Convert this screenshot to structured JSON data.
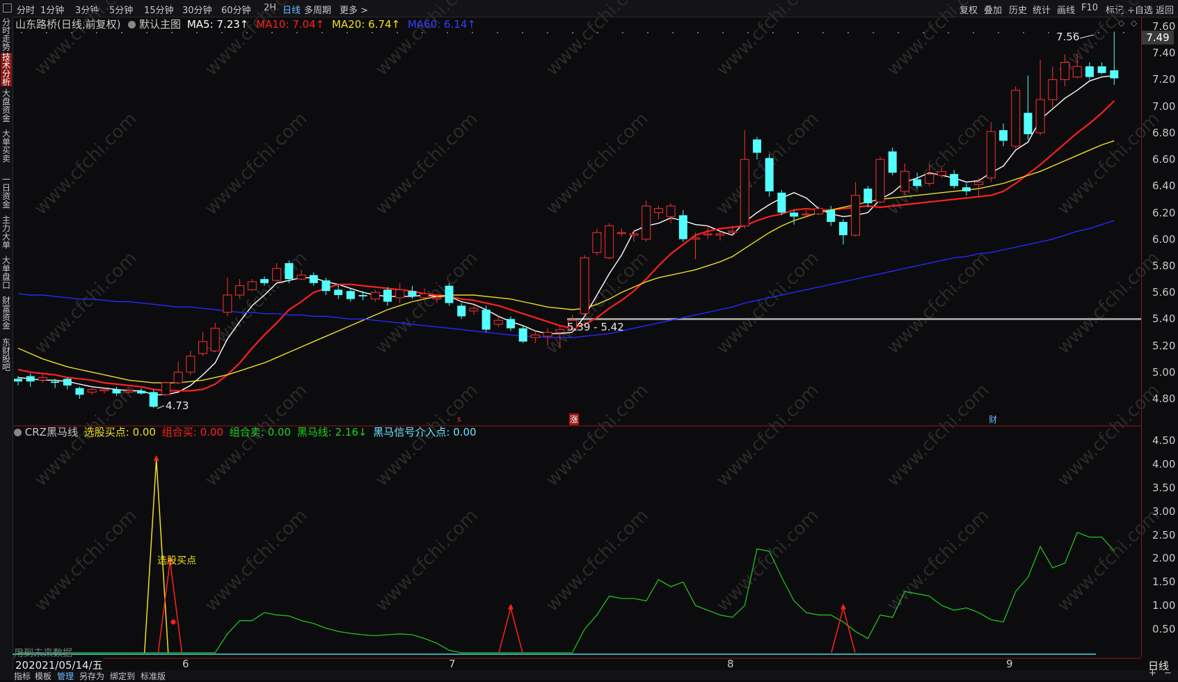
{
  "top_tabs": {
    "left_icon": "window-icon",
    "items": [
      "分时",
      "1分钟",
      "3分钟",
      "5分钟",
      "15分钟",
      "30分钟",
      "60分钟",
      "2H",
      "日线",
      "多周期",
      "更多 >"
    ],
    "active_index": 8,
    "right_items": [
      "复权",
      "叠加",
      "历史",
      "统计",
      "画线",
      "F10",
      "标记",
      "+自选",
      "返回"
    ]
  },
  "sidebar": [
    "分时走势",
    "技术分析",
    "大盘资金",
    "大单买卖",
    "一日资金",
    "主力大单",
    "大单盘口",
    "财富资金",
    "东财股吧"
  ],
  "sidebar_active": 1,
  "main_legend": {
    "title": "山东路桥(日线,前复权)",
    "template": "默认主图",
    "ma5": "MA5: 7.23↑",
    "ma10": "MA10: 7.04↑",
    "ma20": "MA20: 6.74↑",
    "ma60": "MA60: 6.14↑",
    "ma5_color": "#ffffff",
    "ma10_color": "#ff2020",
    "ma20_color": "#f0e020",
    "ma60_color": "#2828ff"
  },
  "price_axis": [
    "7.60",
    "7.40",
    "7.20",
    "7.00",
    "6.80",
    "6.60",
    "6.40",
    "6.20",
    "6.00",
    "5.80",
    "5.60",
    "5.40",
    "5.20",
    "5.00",
    "4.80"
  ],
  "current_price": "7.49",
  "annotations": {
    "high": "7.56",
    "low": "4.73",
    "range": "5.39 - 5.42"
  },
  "markers": {
    "s": "s",
    "zhang": "涨",
    "cai": "财"
  },
  "indicator_legend": {
    "name": "CRZ黑马线",
    "item1": "选股买点: 0.00",
    "item2": "组合买: 0.00",
    "item3": "组合卖: 0.00",
    "item4": "黑马线: 2.16↓",
    "item5": "黑马信号介入点: 0.00"
  },
  "indicator_axis": [
    "4.50",
    "4.00",
    "3.50",
    "3.00",
    "2.50",
    "2.00",
    "1.50",
    "1.00",
    "0.50"
  ],
  "indicator_label": "选股买点",
  "future_data_note": "用到未来数据",
  "date_axis": {
    "first": "2021/05/14/五",
    "months": [
      "6",
      "7",
      "8",
      "9"
    ]
  },
  "period_label": "日线",
  "bottom_tabs": [
    "指标",
    "模板",
    "管理",
    "另存为",
    "绑定到",
    "标准版"
  ],
  "bottom_active": 2,
  "watermark": "www.cfchi.com",
  "chart_data": {
    "type": "candlestick",
    "title": "山东路桥(日线,前复权)",
    "ylim": [
      4.7,
      7.62
    ],
    "candles": [
      [
        4.95,
        4.93,
        4.97,
        4.9
      ],
      [
        4.97,
        4.93,
        4.99,
        4.89
      ],
      [
        4.94,
        4.96,
        4.99,
        4.92
      ],
      [
        4.93,
        4.92,
        4.95,
        4.88
      ],
      [
        4.95,
        4.9,
        4.96,
        4.87
      ],
      [
        4.88,
        4.83,
        4.89,
        4.8
      ],
      [
        4.85,
        4.87,
        4.88,
        4.83
      ],
      [
        4.86,
        4.87,
        4.88,
        4.84
      ],
      [
        4.87,
        4.84,
        4.89,
        4.82
      ],
      [
        4.85,
        4.86,
        4.88,
        4.84
      ],
      [
        4.86,
        4.84,
        4.88,
        4.83
      ],
      [
        4.85,
        4.74,
        4.87,
        4.73
      ],
      [
        4.83,
        4.92,
        4.93,
        4.83
      ],
      [
        4.92,
        5.0,
        5.08,
        4.91
      ],
      [
        5.0,
        5.12,
        5.16,
        4.98
      ],
      [
        5.14,
        5.23,
        5.3,
        5.12
      ],
      [
        5.16,
        5.33,
        5.37,
        5.15
      ],
      [
        5.45,
        5.58,
        5.71,
        5.42
      ],
      [
        5.58,
        5.65,
        5.7,
        5.55
      ],
      [
        5.62,
        5.68,
        5.7,
        5.61
      ],
      [
        5.7,
        5.67,
        5.72,
        5.65
      ],
      [
        5.69,
        5.78,
        5.82,
        5.68
      ],
      [
        5.82,
        5.7,
        5.84,
        5.67
      ],
      [
        5.7,
        5.73,
        5.77,
        5.69
      ],
      [
        5.73,
        5.67,
        5.75,
        5.65
      ],
      [
        5.69,
        5.61,
        5.71,
        5.58
      ],
      [
        5.62,
        5.58,
        5.66,
        5.55
      ],
      [
        5.61,
        5.55,
        5.63,
        5.53
      ],
      [
        5.58,
        5.57,
        5.61,
        5.54
      ],
      [
        5.55,
        5.6,
        5.62,
        5.53
      ],
      [
        5.62,
        5.53,
        5.64,
        5.5
      ],
      [
        5.56,
        5.62,
        5.67,
        5.52
      ],
      [
        5.61,
        5.57,
        5.65,
        5.55
      ],
      [
        5.56,
        5.59,
        5.63,
        5.55
      ],
      [
        5.55,
        5.56,
        5.58,
        5.52
      ],
      [
        5.65,
        5.52,
        5.67,
        5.5
      ],
      [
        5.5,
        5.42,
        5.52,
        5.4
      ],
      [
        5.46,
        5.48,
        5.5,
        5.43
      ],
      [
        5.47,
        5.32,
        5.5,
        5.3
      ],
      [
        5.36,
        5.39,
        5.42,
        5.34
      ],
      [
        5.4,
        5.33,
        5.42,
        5.31
      ],
      [
        5.33,
        5.23,
        5.35,
        5.22
      ],
      [
        5.26,
        5.28,
        5.31,
        5.22
      ],
      [
        5.27,
        5.3,
        5.33,
        5.2
      ],
      [
        5.3,
        5.32,
        5.35,
        5.18
      ],
      [
        5.33,
        5.39,
        5.43,
        5.3
      ],
      [
        5.44,
        5.86,
        5.88,
        5.42
      ],
      [
        5.9,
        6.05,
        6.08,
        5.88
      ],
      [
        5.86,
        6.1,
        6.12,
        5.85
      ],
      [
        6.05,
        6.05,
        6.08,
        6.02
      ],
      [
        6.03,
        6.04,
        6.07,
        5.98
      ],
      [
        6.0,
        6.25,
        6.29,
        5.98
      ],
      [
        6.2,
        6.23,
        6.25,
        6.15
      ],
      [
        6.17,
        6.25,
        6.27,
        6.12
      ],
      [
        6.18,
        6.0,
        6.22,
        5.98
      ],
      [
        6.0,
        6.01,
        6.05,
        5.85
      ],
      [
        6.04,
        6.04,
        6.1,
        6.0
      ],
      [
        6.03,
        6.04,
        6.08,
        5.99
      ],
      [
        6.05,
        6.06,
        6.1,
        6.03
      ],
      [
        6.1,
        6.6,
        6.82,
        6.08
      ],
      [
        6.75,
        6.65,
        6.77,
        6.6
      ],
      [
        6.61,
        6.36,
        6.64,
        6.32
      ],
      [
        6.35,
        6.2,
        6.37,
        6.18
      ],
      [
        6.2,
        6.17,
        6.22,
        6.11
      ],
      [
        6.19,
        6.19,
        6.22,
        6.16
      ],
      [
        6.19,
        6.23,
        6.25,
        6.18
      ],
      [
        6.22,
        6.13,
        6.25,
        6.1
      ],
      [
        6.13,
        6.03,
        6.15,
        5.96
      ],
      [
        6.03,
        6.33,
        6.43,
        6.02
      ],
      [
        6.38,
        6.27,
        6.4,
        6.24
      ],
      [
        6.28,
        6.6,
        6.62,
        6.27
      ],
      [
        6.66,
        6.5,
        6.69,
        6.48
      ],
      [
        6.36,
        6.51,
        6.57,
        6.33
      ],
      [
        6.45,
        6.4,
        6.5,
        6.38
      ],
      [
        6.42,
        6.49,
        6.56,
        6.4
      ],
      [
        6.48,
        6.51,
        6.54,
        6.46
      ],
      [
        6.49,
        6.4,
        6.52,
        6.38
      ],
      [
        6.39,
        6.36,
        6.42,
        6.33
      ],
      [
        6.41,
        6.43,
        6.46,
        6.32
      ],
      [
        6.46,
        6.81,
        6.88,
        6.43
      ],
      [
        6.82,
        6.74,
        6.87,
        6.7
      ],
      [
        6.7,
        7.12,
        7.15,
        6.68
      ],
      [
        6.95,
        6.79,
        7.23,
        6.75
      ],
      [
        6.8,
        7.05,
        7.35,
        6.78
      ],
      [
        7.05,
        7.2,
        7.3,
        6.99
      ],
      [
        7.2,
        7.33,
        7.39,
        7.15
      ],
      [
        7.22,
        7.3,
        7.4,
        7.21
      ],
      [
        7.3,
        7.22,
        7.33,
        7.2
      ],
      [
        7.3,
        7.25,
        7.33,
        7.24
      ],
      [
        7.27,
        7.21,
        7.56,
        7.16
      ]
    ],
    "series": [
      {
        "name": "MA5",
        "color": "#ffffff",
        "values": [
          4.96,
          4.95,
          4.94,
          4.94,
          4.93,
          4.91,
          4.89,
          4.88,
          4.87,
          4.86,
          4.86,
          4.83,
          4.83,
          4.85,
          4.9,
          4.98,
          5.07,
          5.25,
          5.38,
          5.5,
          5.58,
          5.67,
          5.69,
          5.71,
          5.71,
          5.68,
          5.66,
          5.63,
          5.6,
          5.58,
          5.57,
          5.57,
          5.57,
          5.58,
          5.57,
          5.57,
          5.53,
          5.51,
          5.47,
          5.42,
          5.38,
          5.35,
          5.31,
          5.29,
          5.29,
          5.3,
          5.42,
          5.58,
          5.74,
          5.88,
          6.06,
          6.1,
          6.12,
          6.16,
          6.14,
          6.11,
          6.1,
          6.06,
          6.03,
          6.13,
          6.2,
          6.26,
          6.31,
          6.35,
          6.31,
          6.23,
          6.19,
          6.17,
          6.18,
          6.2,
          6.3,
          6.35,
          6.43,
          6.46,
          6.5,
          6.48,
          6.46,
          6.43,
          6.44,
          6.5,
          6.55,
          6.67,
          6.73,
          6.9,
          6.98,
          7.06,
          7.12,
          7.19,
          7.22,
          7.23
        ]
      },
      {
        "name": "MA10",
        "color": "#ff2020",
        "values": [
          5.02,
          5.0,
          4.99,
          4.98,
          4.96,
          4.95,
          4.94,
          4.92,
          4.91,
          4.9,
          4.89,
          4.87,
          4.86,
          4.86,
          4.86,
          4.87,
          4.91,
          4.98,
          5.07,
          5.18,
          5.28,
          5.37,
          5.47,
          5.53,
          5.6,
          5.63,
          5.66,
          5.66,
          5.65,
          5.64,
          5.63,
          5.62,
          5.61,
          5.59,
          5.58,
          5.57,
          5.55,
          5.54,
          5.52,
          5.5,
          5.47,
          5.44,
          5.41,
          5.38,
          5.35,
          5.33,
          5.36,
          5.41,
          5.48,
          5.54,
          5.61,
          5.7,
          5.8,
          5.89,
          5.96,
          6.03,
          6.06,
          6.08,
          6.09,
          6.1,
          6.14,
          6.17,
          6.19,
          6.22,
          6.23,
          6.22,
          6.22,
          6.23,
          6.24,
          6.25,
          6.24,
          6.25,
          6.26,
          6.27,
          6.28,
          6.29,
          6.3,
          6.31,
          6.32,
          6.33,
          6.36,
          6.42,
          6.49,
          6.56,
          6.64,
          6.72,
          6.8,
          6.87,
          6.95,
          7.04
        ]
      },
      {
        "name": "MA20",
        "color": "#f0e020",
        "values": [
          5.18,
          5.14,
          5.1,
          5.07,
          5.04,
          5.02,
          5.0,
          4.98,
          4.96,
          4.94,
          4.93,
          4.92,
          4.92,
          4.92,
          4.93,
          4.94,
          4.96,
          4.98,
          5.01,
          5.04,
          5.07,
          5.11,
          5.15,
          5.19,
          5.23,
          5.27,
          5.31,
          5.35,
          5.39,
          5.43,
          5.47,
          5.5,
          5.53,
          5.55,
          5.57,
          5.58,
          5.58,
          5.58,
          5.57,
          5.56,
          5.55,
          5.53,
          5.51,
          5.49,
          5.48,
          5.47,
          5.48,
          5.51,
          5.55,
          5.6,
          5.64,
          5.68,
          5.71,
          5.73,
          5.75,
          5.77,
          5.8,
          5.83,
          5.87,
          5.93,
          5.99,
          6.05,
          6.1,
          6.14,
          6.17,
          6.2,
          6.22,
          6.24,
          6.26,
          6.28,
          6.3,
          6.31,
          6.32,
          6.33,
          6.34,
          6.35,
          6.36,
          6.37,
          6.38,
          6.4,
          6.42,
          6.45,
          6.48,
          6.51,
          6.55,
          6.59,
          6.63,
          6.67,
          6.71,
          6.74
        ]
      },
      {
        "name": "MA60",
        "color": "#2828ff",
        "values": [
          5.59,
          5.58,
          5.58,
          5.57,
          5.56,
          5.55,
          5.55,
          5.54,
          5.53,
          5.53,
          5.52,
          5.51,
          5.5,
          5.49,
          5.49,
          5.48,
          5.47,
          5.46,
          5.45,
          5.45,
          5.44,
          5.44,
          5.43,
          5.43,
          5.42,
          5.42,
          5.41,
          5.4,
          5.4,
          5.39,
          5.38,
          5.37,
          5.36,
          5.35,
          5.34,
          5.33,
          5.32,
          5.31,
          5.3,
          5.29,
          5.28,
          5.27,
          5.27,
          5.26,
          5.26,
          5.26,
          5.27,
          5.28,
          5.29,
          5.31,
          5.33,
          5.35,
          5.37,
          5.39,
          5.41,
          5.43,
          5.45,
          5.47,
          5.49,
          5.52,
          5.54,
          5.56,
          5.58,
          5.6,
          5.62,
          5.64,
          5.66,
          5.68,
          5.7,
          5.72,
          5.74,
          5.76,
          5.78,
          5.8,
          5.82,
          5.84,
          5.86,
          5.87,
          5.89,
          5.9,
          5.92,
          5.94,
          5.96,
          5.98,
          6.0,
          6.03,
          6.06,
          6.08,
          6.11,
          6.14
        ]
      }
    ],
    "indicator": {
      "ylim": [
        0,
        4.7
      ],
      "black_horse_line": [
        0,
        0,
        0,
        0,
        0,
        0,
        0,
        0,
        0,
        0,
        0,
        0,
        0,
        0,
        0,
        0,
        0,
        0.4,
        0.68,
        0.68,
        0.85,
        0.8,
        0.78,
        0.68,
        0.62,
        0.52,
        0.45,
        0.41,
        0.38,
        0.36,
        0.38,
        0.4,
        0.38,
        0.3,
        0.2,
        0.05,
        0,
        0,
        0,
        0,
        0,
        0,
        0,
        0,
        0,
        0,
        0.5,
        0.8,
        1.2,
        1.15,
        1.15,
        1.1,
        1.55,
        1.4,
        1.5,
        1.0,
        0.9,
        0.8,
        0.75,
        1.0,
        2.2,
        2.15,
        1.6,
        1.1,
        0.85,
        0.8,
        0.8,
        0.65,
        0.45,
        0.3,
        0.8,
        0.75,
        1.3,
        1.25,
        1.2,
        1.0,
        0.9,
        0.95,
        0.85,
        0.7,
        0.65,
        1.3,
        1.6,
        2.25,
        1.8,
        1.9,
        2.55,
        2.45,
        2.45,
        2.16
      ],
      "spikes": [
        {
          "index": 11,
          "value": 4.1,
          "color": "#f0e020"
        },
        {
          "index": 12,
          "value": 1.95,
          "color": "#ff2020"
        },
        {
          "index": 40,
          "value": 0.95,
          "color": "#ff2020"
        },
        {
          "index": 67,
          "value": 0.95,
          "color": "#ff2020"
        }
      ]
    }
  }
}
